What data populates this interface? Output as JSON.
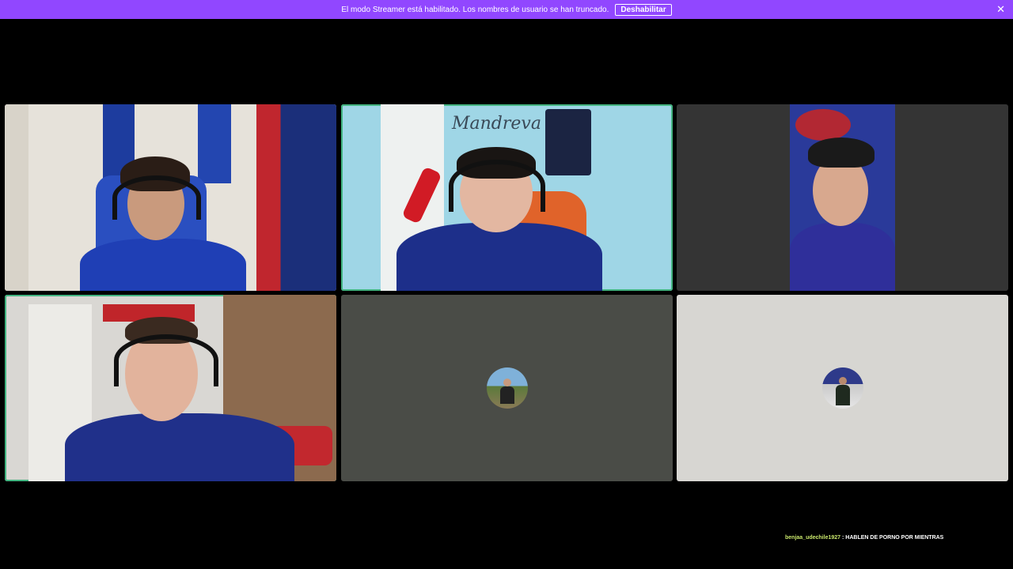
{
  "banner": {
    "message": "El modo Streamer está habilitado. Los nombres de usuario se han truncado.",
    "disable_label": "Deshabilitar",
    "close_icon": "close-icon"
  },
  "tiles": [
    {
      "name": "participant-tile-1",
      "speaking": false
    },
    {
      "name": "participant-tile-2",
      "speaking": true,
      "wall_text": "Mandreva"
    },
    {
      "name": "participant-tile-3",
      "speaking": false
    },
    {
      "name": "participant-tile-4",
      "speaking": true
    },
    {
      "name": "participant-tile-5",
      "speaking": false,
      "camera_off": true
    },
    {
      "name": "participant-tile-6",
      "speaking": false,
      "camera_off": true
    }
  ],
  "chat": {
    "username": "benjaa_udechile1927",
    "separator": " : ",
    "message": "HABLEN DE PORNO POR MIENTRAS"
  },
  "colors": {
    "banner": "#9147ff",
    "speaking_border": "#43b581",
    "tile5_bg": "#4a4c47",
    "tile6_bg": "#d7d6d2"
  }
}
